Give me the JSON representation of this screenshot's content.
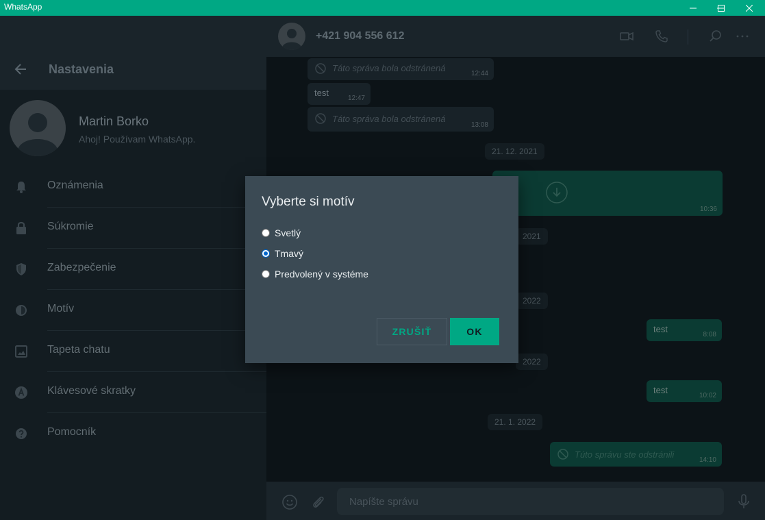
{
  "window": {
    "title": "WhatsApp"
  },
  "settings": {
    "title": "Nastavenia",
    "profile": {
      "name": "Martin Borko",
      "status": "Ahoj! Používam WhatsApp."
    },
    "menu": [
      {
        "label": "Oznámenia",
        "icon": "bell-icon"
      },
      {
        "label": "Súkromie",
        "icon": "lock-icon"
      },
      {
        "label": "Zabezpečenie",
        "icon": "shield-icon"
      },
      {
        "label": "Motív",
        "icon": "theme-icon"
      },
      {
        "label": "Tapeta chatu",
        "icon": "wallpaper-icon"
      },
      {
        "label": "Klávesové skratky",
        "icon": "keyboard-shortcuts-icon"
      },
      {
        "label": "Pomocník",
        "icon": "help-icon"
      }
    ]
  },
  "chat": {
    "contact": "+421 904 556 612",
    "messages": [
      {
        "text": "Táto správa bola odstránená",
        "time": "12:44"
      },
      {
        "text": "test",
        "time": "12:47"
      },
      {
        "text": "Táto správa bola odstránená",
        "time": "13:08"
      },
      {
        "text": "10:36"
      },
      {
        "text": "test",
        "time": "8:08"
      },
      {
        "text": "test",
        "time": "10:02"
      },
      {
        "text": "Túto správu ste odstránili",
        "time": "14:10"
      }
    ],
    "dates": [
      "21. 12. 2021",
      "2021",
      "2022",
      "2022",
      "21. 1. 2022"
    ],
    "composer_placeholder": "Napíšte správu"
  },
  "dialog": {
    "title": "Vyberte si motív",
    "options": [
      {
        "label": "Svetlý",
        "checked": false
      },
      {
        "label": "Tmavý",
        "checked": true
      },
      {
        "label": "Predvolený v systéme",
        "checked": false
      }
    ],
    "cancel_label": "ZRUŠIŤ",
    "ok_label": "OK"
  },
  "colors": {
    "accent": "#00a884",
    "dialog_bg": "#3b4a54",
    "app_bg": "#131c21"
  }
}
